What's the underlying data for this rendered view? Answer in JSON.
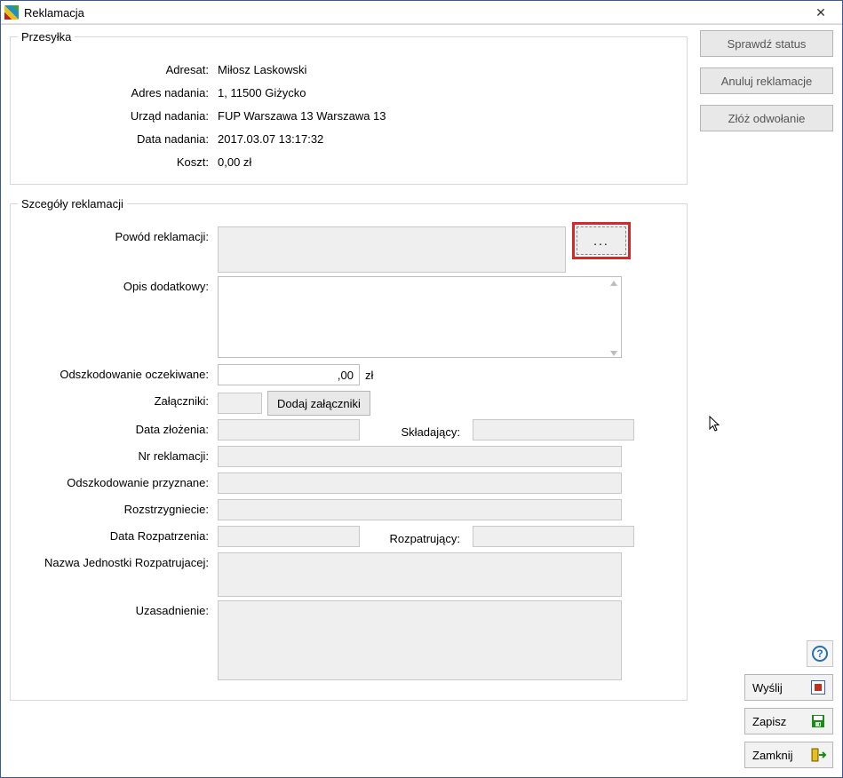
{
  "window": {
    "title": "Reklamacja"
  },
  "shipment": {
    "legend": "Przesyłka",
    "rows": {
      "addressee_label": "Adresat:",
      "addressee_value": "Miłosz Laskowski",
      "sender_addr_label": "Adres nadania:",
      "sender_addr_value": "1, 11500 Giżycko",
      "office_label": "Urząd nadania:",
      "office_value": "FUP Warszawa 13 Warszawa 13",
      "date_label": "Data nadania:",
      "date_value": "2017.03.07 13:17:32",
      "cost_label": "Koszt:",
      "cost_value": "0,00 zł"
    }
  },
  "details": {
    "legend": "Szcegóły reklamacji",
    "reason_label": "Powód reklamacji:",
    "reason_value": "",
    "dots_label": "...",
    "desc_label": "Opis dodatkowy:",
    "desc_value": "",
    "comp_expected_label": "Odszkodowanie oczekiwane:",
    "comp_expected_value": ",00",
    "comp_expected_unit": "zł",
    "attachments_label": "Załączniki:",
    "attachments_count": "",
    "add_attachments_btn": "Dodaj załączniki",
    "submit_date_label": "Data złożenia:",
    "submit_date_value": "",
    "submitter_label": "Składający:",
    "submitter_value": "",
    "claim_no_label": "Nr reklamacji:",
    "claim_no_value": "",
    "comp_granted_label": "Odszkodowanie przyznane:",
    "comp_granted_value": "",
    "resolution_label": "Rozstrzygniecie:",
    "resolution_value": "",
    "review_date_label": "Data Rozpatrzenia:",
    "review_date_value": "",
    "reviewer_label": "Rozpatrujący:",
    "reviewer_value": "",
    "unit_name_label": "Nazwa Jednostki Rozpatrujacej:",
    "unit_name_value": "",
    "justification_label": "Uzasadnienie:",
    "justification_value": ""
  },
  "sidebar": {
    "check_status": "Sprawdź status",
    "cancel_claims": "Anuluj reklamacje",
    "appeal": "Złóż odwołanie",
    "send": "Wyślij",
    "save": "Zapisz",
    "close": "Zamknij"
  }
}
